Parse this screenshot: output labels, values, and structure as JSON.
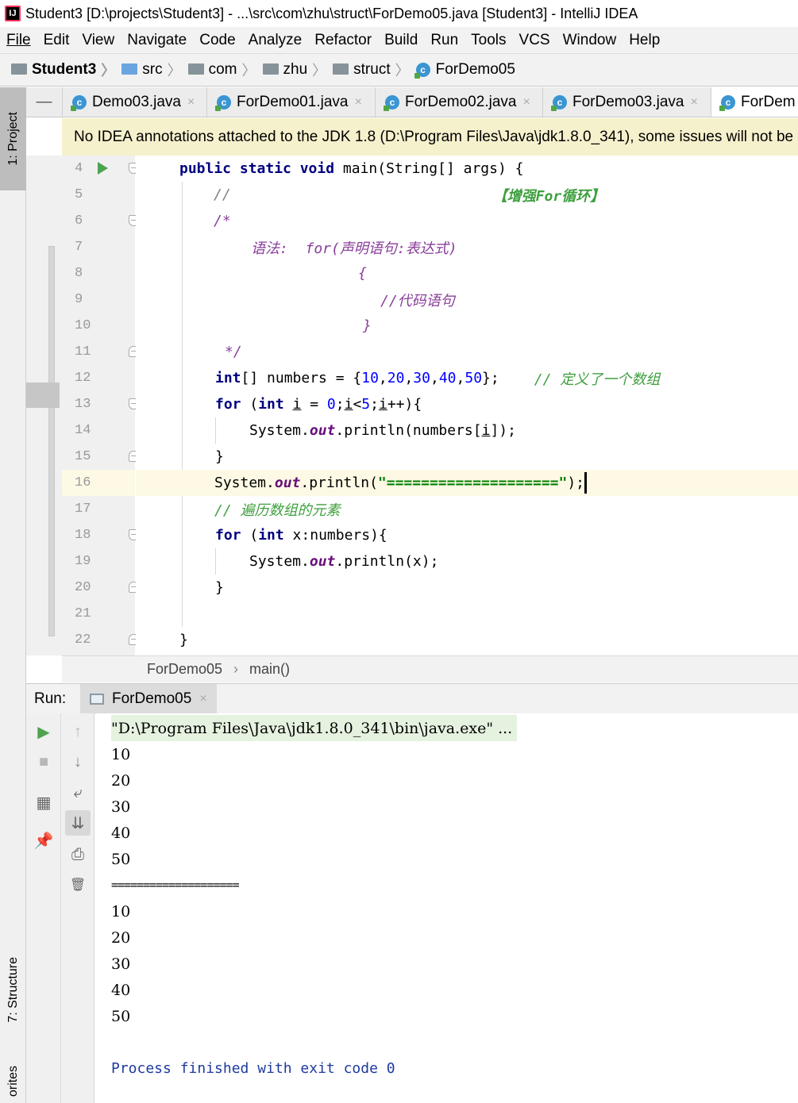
{
  "window": {
    "title": "Student3 [D:\\projects\\Student3] - ...\\src\\com\\zhu\\struct\\ForDemo05.java [Student3] - IntelliJ IDEA",
    "logo": "IJ"
  },
  "menu": [
    "File",
    "Edit",
    "View",
    "Navigate",
    "Code",
    "Analyze",
    "Refactor",
    "Build",
    "Run",
    "Tools",
    "VCS",
    "Window",
    "Help"
  ],
  "breadcrumbs": [
    "Student3",
    "src",
    "com",
    "zhu",
    "struct",
    "ForDemo05"
  ],
  "side_tabs": {
    "project": "1: Project",
    "structure": "7: Structure",
    "favorites": "orites"
  },
  "tabs": [
    {
      "label": "Demo03.java",
      "close": "×"
    },
    {
      "label": "ForDemo01.java",
      "close": "×"
    },
    {
      "label": "ForDemo02.java",
      "close": "×"
    },
    {
      "label": "ForDemo03.java",
      "close": "×"
    },
    {
      "label": "ForDem",
      "close": ""
    }
  ],
  "tab_minimize": "—",
  "banner": "No IDEA annotations attached to the JDK 1.8 (D:\\Program Files\\Java\\jdk1.8.0_341), some issues will not be",
  "line_numbers": [
    "4",
    "5",
    "6",
    "7",
    "8",
    "9",
    "10",
    "11",
    "12",
    "13",
    "14",
    "15",
    "16",
    "17",
    "18",
    "19",
    "20",
    "21",
    "22"
  ],
  "code": {
    "l4a": "public static void",
    "l4b": " main(String[] args) {",
    "l5a": "//",
    "l5b": "【增强For循环】",
    "l6": "/*",
    "l7": "语法:  for(声明语句:表达式)",
    "l8": "{",
    "l9": "//代码语句",
    "l10": "}",
    "l11": "*/",
    "l12a": "int",
    "l12b": "[] numbers = {",
    "l12n1": "10",
    "l12c1": ",",
    "l12n2": "20",
    "l12c2": ",",
    "l12n3": "30",
    "l12c3": ",",
    "l12n4": "40",
    "l12c4": ",",
    "l12n5": "50",
    "l12d": "};",
    "l12cm": "// 定义了一个数组",
    "l13a": "for",
    "l13b": " (",
    "l13c": "int",
    "l13d": " ",
    "l13i": "i",
    "l13e": " = ",
    "l13n0": "0",
    "l13f": ";",
    "l13i2": "i",
    "l13g": "<",
    "l13n5": "5",
    "l13h": ";",
    "l13i3": "i",
    "l13j": "++){",
    "l14a": "System.",
    "l14b": "out",
    "l14c": ".println(numbers[",
    "l14i": "i",
    "l14d": "]);",
    "l15": "}",
    "l16a": "System.",
    "l16b": "out",
    "l16c": ".println(",
    "l16s": "\"====================\"",
    "l16d": ");",
    "l17": "// 遍历数组的元素",
    "l18a": "for",
    "l18b": " (",
    "l18c": "int",
    "l18d": " x:numbers){",
    "l19a": "System.",
    "l19b": "out",
    "l19c": ".println(x);",
    "l20": "}",
    "l22": "}"
  },
  "editor_crumbs": {
    "cls": "ForDemo05",
    "arrow": "›",
    "method": "main()"
  },
  "run": {
    "label": "Run:",
    "tab": "ForDemo05",
    "close": "×"
  },
  "console": {
    "cmd": "\"D:\\Program Files\\Java\\jdk1.8.0_341\\bin\\java.exe\" ...",
    "lines": [
      "10",
      "20",
      "30",
      "40",
      "50",
      "====================",
      "10",
      "20",
      "30",
      "40",
      "50"
    ],
    "finished": "Process finished with exit code 0"
  },
  "toolbar_icons": {
    "rerun": "▶",
    "stop": "■",
    "up": "↑",
    "down": "↓",
    "wrap": "⤶",
    "scroll": "⇊",
    "print": "⎙",
    "trash": "🗑",
    "layout": "▦",
    "pin": "📌"
  }
}
